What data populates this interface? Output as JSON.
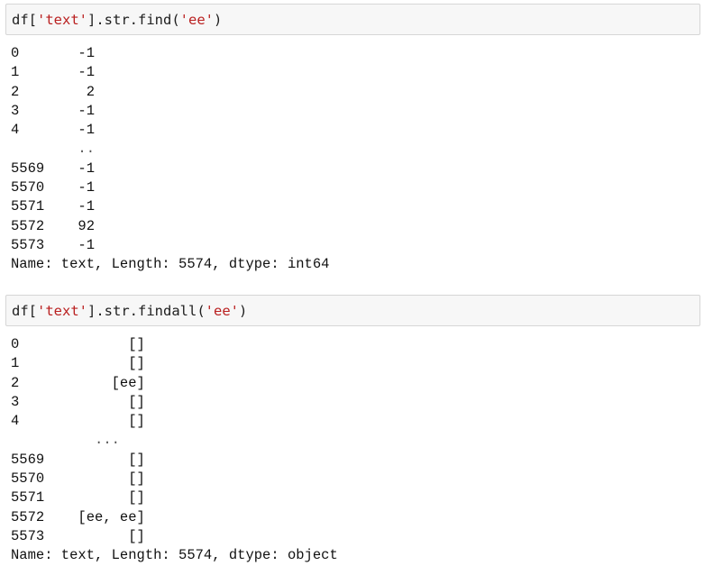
{
  "cells": [
    {
      "code": {
        "prefix": "df[",
        "string1": "'text'",
        "middle": "].str.find(",
        "string2": "'ee'",
        "suffix": ")"
      },
      "output": [
        "0       -1",
        "1       -1",
        "2        2",
        "3       -1",
        "4       -1",
        "        ..",
        "5569    -1",
        "5570    -1",
        "5571    -1",
        "5572    92",
        "5573    -1",
        "Name: text, Length: 5574, dtype: int64"
      ]
    },
    {
      "code": {
        "prefix": "df[",
        "string1": "'text'",
        "middle": "].str.findall(",
        "string2": "'ee'",
        "suffix": ")"
      },
      "output": [
        "0             []",
        "1             []",
        "2           [ee]",
        "3             []",
        "4             []",
        "          ...",
        "5569          []",
        "5570          []",
        "5571          []",
        "5572    [ee, ee]",
        "5573          []",
        "Name: text, Length: 5574, dtype: object"
      ]
    }
  ],
  "colors": {
    "string": "#ba2121",
    "cell_background": "#f7f7f7",
    "cell_border": "#d6d6d6"
  }
}
